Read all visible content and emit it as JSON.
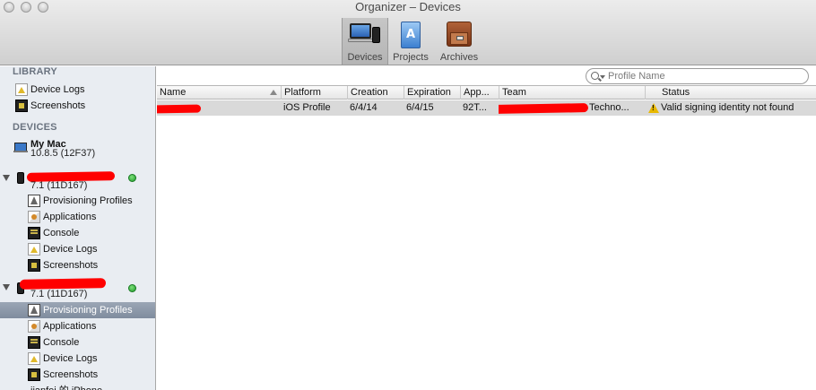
{
  "window": {
    "title": "Organizer – Devices"
  },
  "toolbar": {
    "items": [
      {
        "label": "Devices",
        "icon": "devices-icon"
      },
      {
        "label": "Projects",
        "icon": "projects-icon"
      },
      {
        "label": "Archives",
        "icon": "archives-icon"
      }
    ]
  },
  "sidebar": {
    "library_header": "LIBRARY",
    "library": [
      {
        "label": "Device Logs",
        "icon": "device-logs-icon"
      },
      {
        "label": "Screenshots",
        "icon": "screenshots-icon"
      }
    ],
    "devices_header": "DEVICES",
    "mac": {
      "name": "My Mac",
      "version": "10.8.5 (12F37)"
    },
    "device1": {
      "version": "7.1 (11D167)",
      "status_color": "#2ab03a",
      "items": [
        {
          "label": "Provisioning Profiles"
        },
        {
          "label": "Applications"
        },
        {
          "label": "Console"
        },
        {
          "label": "Device Logs"
        },
        {
          "label": "Screenshots"
        }
      ]
    },
    "device2": {
      "version": "7.1 (11D167)",
      "status_color": "#2ab03a",
      "items": [
        {
          "label": "Provisioning Profiles",
          "selected": true
        },
        {
          "label": "Applications"
        },
        {
          "label": "Console"
        },
        {
          "label": "Device Logs"
        },
        {
          "label": "Screenshots"
        }
      ]
    },
    "next_device_partial": "jianfei 的 iPhone"
  },
  "search": {
    "placeholder": "Profile Name"
  },
  "table": {
    "columns": [
      "Name",
      "Platform",
      "Creation",
      "Expiration",
      "App...",
      "Team",
      "Status"
    ],
    "rows": [
      {
        "name": "",
        "platform": "iOS Profile",
        "creation": "6/4/14",
        "expiration": "6/4/15",
        "app": "92T...",
        "team": "Techno...",
        "status": "Valid signing identity not found"
      }
    ]
  }
}
